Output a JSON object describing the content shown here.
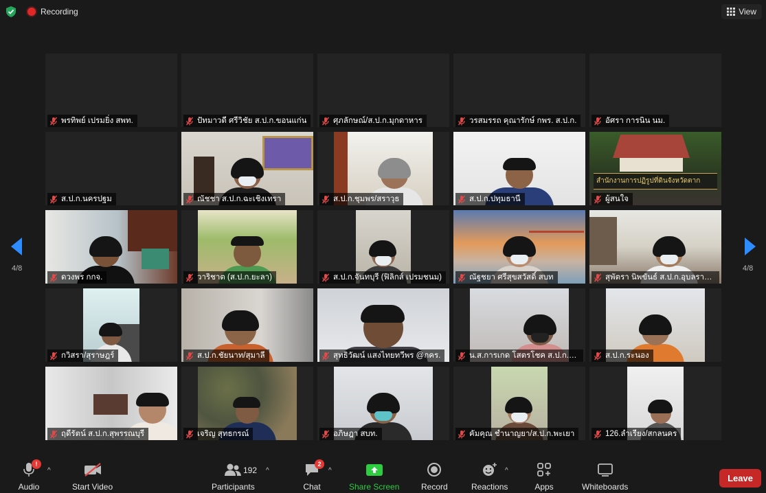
{
  "topbar": {
    "recording_label": "Recording",
    "view_label": "View"
  },
  "navigation": {
    "left_page": "4/8",
    "right_page": "4/8"
  },
  "participants": [
    {
      "name": "พรทิพย์ เปรมยิ่ง สพท."
    },
    {
      "name": "ปัทมาวดี ศรีวิชัย ส.ป.ก.ขอนแก่น"
    },
    {
      "name": "ศุภลักษณ์/ส.ป.ก.มุกดาหาร"
    },
    {
      "name": "วรสมรรถ คุณารักษ์ กพร. ส.ป.ก."
    },
    {
      "name": "อัศรา การนิน นม."
    },
    {
      "name": "ส.ป.ก.นครปฐม"
    },
    {
      "name": "ณัชชา ส.ป.ก.ฉะเชิงเทรา"
    },
    {
      "name": "ส.ป.ก.ชุมพร/สราวุธ"
    },
    {
      "name": "ส.ป.ก.ปทุมธานี"
    },
    {
      "name": "ผู้สนใจ",
      "banner_text": "สำนักงานการปฏิรูปที่ดินจังหวัดตาก"
    },
    {
      "name": "ดวงพร กกจ."
    },
    {
      "name": "วาริชาต (ส.ป.ก.ยะลา)"
    },
    {
      "name": "ส.ป.ก.จันทบุรี (ฟิลิกส์ เปรมชนม)"
    },
    {
      "name": "ณัฐชยา ศรีสุขสวัสดิ์ สบท"
    },
    {
      "name": "สุพัตรา นิพขันธ์ ส.ป.ก.อุบลราช..."
    },
    {
      "name": "กวิสรา/สุราษฎร์"
    },
    {
      "name": "ส.ป.ก.ชัยนาท/สุมาลี"
    },
    {
      "name": "สุทธิวัฒน์ แสงไทยทวีพร @กคร."
    },
    {
      "name": "น.ส.การเกด โสตรโชค ส.ป.ก.ฉช"
    },
    {
      "name": "ส.ป.ก.ระนอง"
    },
    {
      "name": "ฤดีรัตน์ ส.ป.ก.สุพรรณบุรี"
    },
    {
      "name": "เจริญ สุทธกรณ์"
    },
    {
      "name": "อภิษฎา สบท."
    },
    {
      "name": "คัมคุณ ชำนาญยา/ส.ป.ก.พะเยา"
    },
    {
      "name": "126.ลำเรียง/สกลนคร"
    }
  ],
  "toolbar": {
    "audio": {
      "label": "Audio",
      "badge": "!"
    },
    "video": {
      "label": "Start Video"
    },
    "participants": {
      "label": "Participants",
      "count": "192"
    },
    "chat": {
      "label": "Chat",
      "badge": "2"
    },
    "share": {
      "label": "Share Screen",
      "color": "#2ecc40"
    },
    "record": {
      "label": "Record"
    },
    "reactions": {
      "label": "Reactions"
    },
    "apps": {
      "label": "Apps"
    },
    "whiteboards": {
      "label": "Whiteboards"
    },
    "leave": {
      "label": "Leave",
      "color": "#c62828"
    }
  }
}
